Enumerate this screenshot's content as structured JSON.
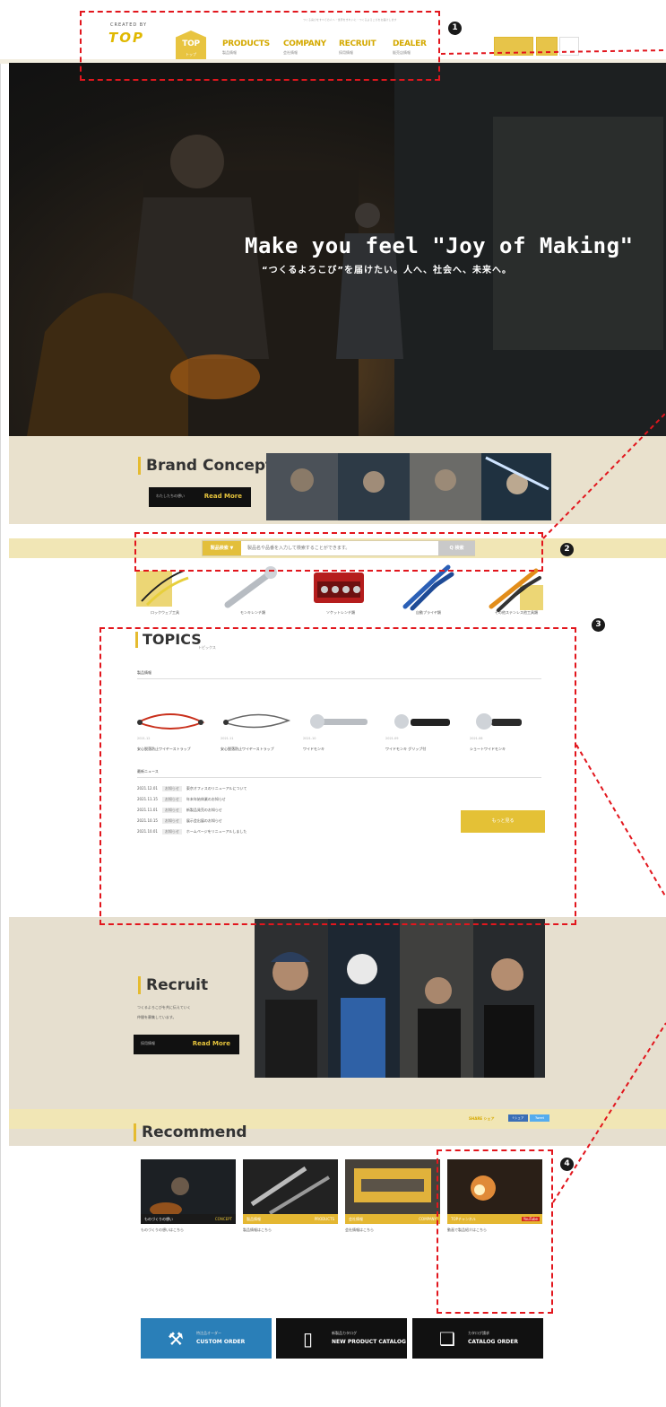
{
  "header": {
    "logo_sub": "CREATED BY",
    "logo": "TOP",
    "util_text": "つくる喜びをすべての人へ・世界をきれいに・つくるよろこびをお届けします",
    "nav": [
      {
        "en": "TOP",
        "jp": "トップ"
      },
      {
        "en": "PRODUCTS",
        "jp": "製品情報"
      },
      {
        "en": "COMPANY",
        "jp": "会社情報"
      },
      {
        "en": "RECRUIT",
        "jp": "採用情報"
      },
      {
        "en": "DEALER",
        "jp": "販売店情報"
      }
    ]
  },
  "hero": {
    "title": "Make you feel \"Joy of Making\"",
    "subtitle": "“つくるよろこび”を届けたい。人へ、社会へ、未来へ。"
  },
  "brand": {
    "heading": "Brand Concept",
    "readmore_jp": "わたしたちの想い",
    "readmore_en": "Read More"
  },
  "search": {
    "category": "製品検索 ▼",
    "placeholder": "製品名や品番を入力して検索することができます。",
    "button": "Q 検索"
  },
  "categories": [
    {
      "label": "ロックウェブ工具"
    },
    {
      "label": "モンキレンチ類"
    },
    {
      "label": "ソケットレンチ類"
    },
    {
      "label": "自動プライヤ類"
    },
    {
      "label": "その他ステンレス他工具類"
    }
  ],
  "topics": {
    "heading": "TOPICS",
    "heading_jp": "トピックス",
    "products_heading": "製品情報",
    "products": [
      {
        "date": "2021.12",
        "name": "安心脱落防止ワイヤーストラップ"
      },
      {
        "date": "2021.11",
        "name": "安心脱落防止ワイヤーストラップ"
      },
      {
        "date": "2021.10",
        "name": "ワイドモンキ"
      },
      {
        "date": "2021.09",
        "name": "ワイドモンキ グリップ付"
      },
      {
        "date": "2021.08",
        "name": "ショートワイドモンキ"
      }
    ],
    "news_heading": "最新ニュース",
    "news": [
      {
        "date": "2021.12.01",
        "tag": "お知らせ",
        "text": "東京オフィスのリニューアルについて"
      },
      {
        "date": "2021.11.15",
        "tag": "お知らせ",
        "text": "年末年始休業のお知らせ"
      },
      {
        "date": "2021.11.01",
        "tag": "お知らせ",
        "text": "新製品発売のお知らせ"
      },
      {
        "date": "2021.10.15",
        "tag": "お知らせ",
        "text": "展示会出展のお知らせ"
      },
      {
        "date": "2021.10.01",
        "tag": "お知らせ",
        "text": "ホームページをリニューアルしました"
      }
    ],
    "more": "もっと見る"
  },
  "recruit": {
    "heading": "Recruit",
    "text_line1": "つくるよろこびを共に伝えていく",
    "text_line2": "仲間を募集しています。",
    "readmore_jp": "採用情報",
    "readmore_en": "Read More"
  },
  "share": {
    "label": "SHARE シェア",
    "buttons": [
      "f シェア",
      "Tweet"
    ]
  },
  "recommend": {
    "heading": "Recommend",
    "cards": [
      {
        "bar_left": "ものづくりの想い",
        "bar_right": "CONCEPT",
        "caption": "ものづくりの想いはこちら",
        "bar_color": "#1a1a1a"
      },
      {
        "bar_left": "製品情報",
        "bar_right": "PRODUCTS",
        "caption": "製品情報はこちら",
        "bar_color": "#e4b732"
      },
      {
        "bar_left": "会社情報",
        "bar_right": "COMPANY",
        "caption": "会社情報はこちら",
        "bar_color": "#e4b732"
      },
      {
        "bar_left": "TOPチャンネル",
        "bar_right": "YouTube",
        "caption": "動画で製品紹介はこちら",
        "bar_color": "#e4b732"
      }
    ]
  },
  "bottom_buttons": [
    {
      "jp": "特注品オーダー",
      "en": "CUSTOM ORDER",
      "icon": "wrench-icon",
      "color": "#2a7fb8"
    },
    {
      "jp": "新製品カタログ",
      "en": "NEW PRODUCT CATALOG",
      "icon": "pdf-icon",
      "color": "#111111"
    },
    {
      "jp": "カタログ請求",
      "en": "CATALOG ORDER",
      "icon": "book-icon",
      "color": "#111111"
    }
  ],
  "callouts": [
    "1",
    "2",
    "3",
    "4"
  ],
  "colors": {
    "accent": "#e4b732",
    "callout": "#e2161d",
    "band": "#e9e1cd"
  }
}
